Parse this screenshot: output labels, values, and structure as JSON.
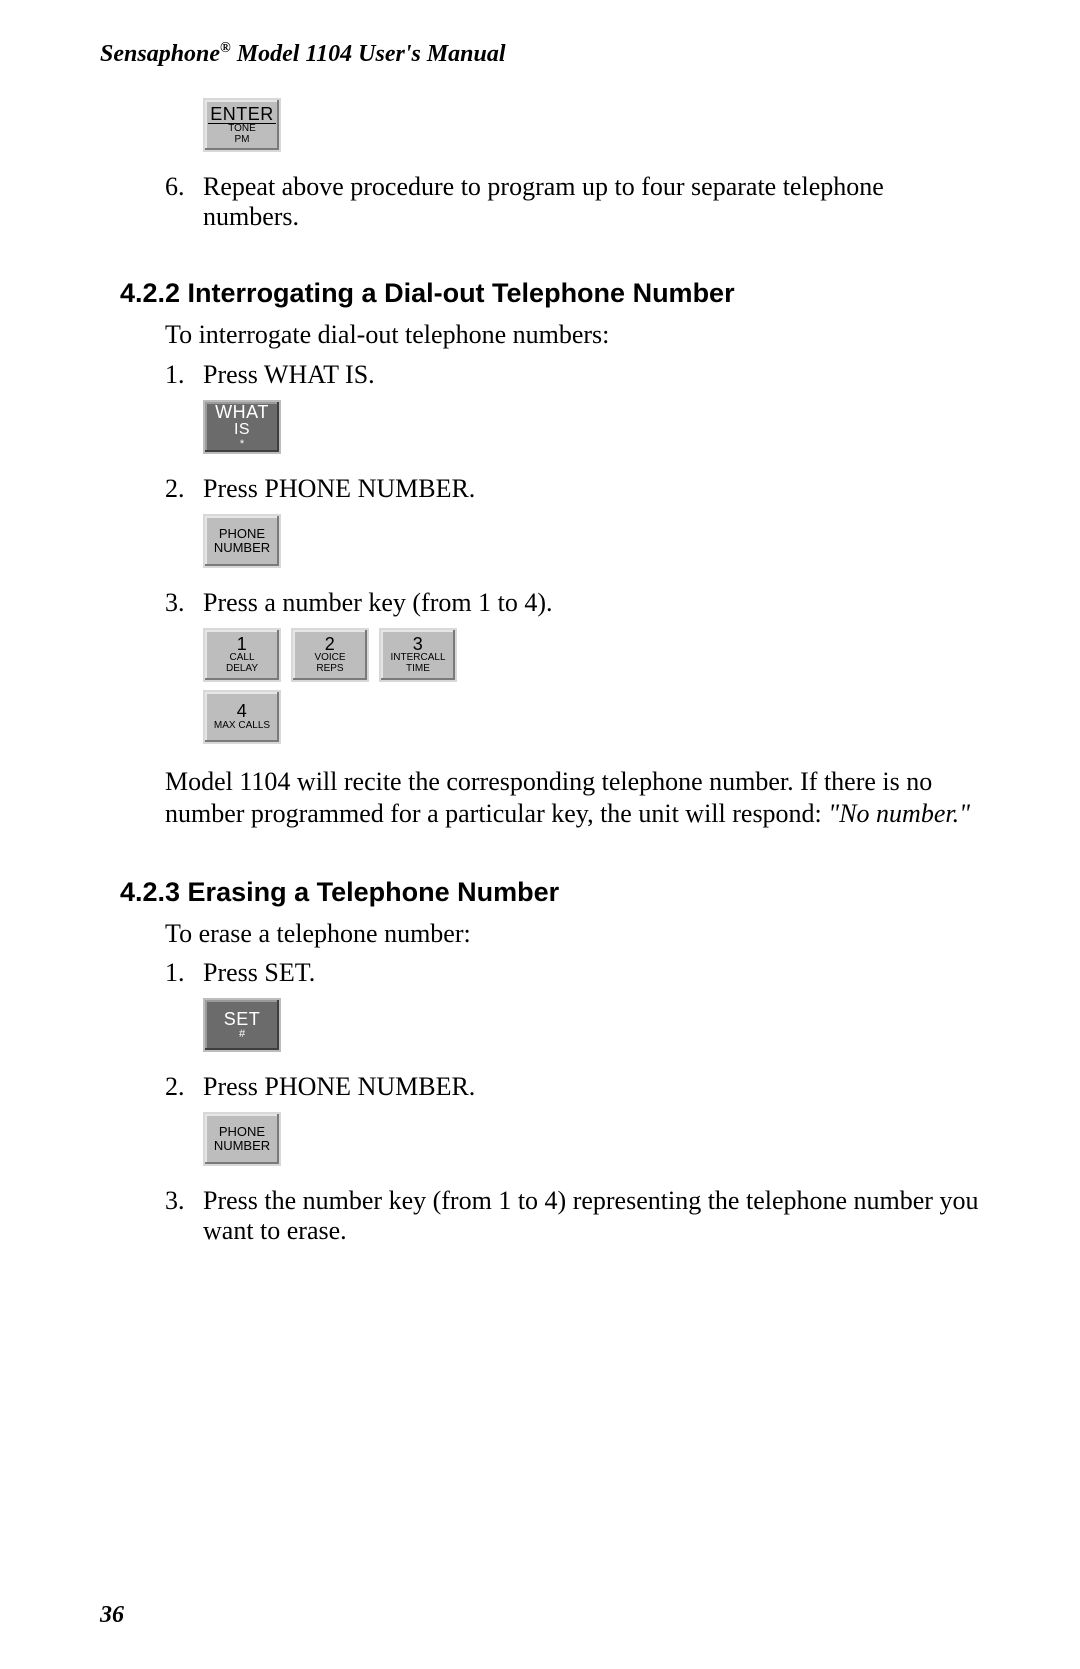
{
  "header": {
    "prefix": "Sensaphone",
    "reg": "®",
    "suffix": " Model 1104 User's Manual"
  },
  "topButton": {
    "line1": "ENTER",
    "line2": "TONE",
    "line3": "PM"
  },
  "item6": {
    "num": "6.",
    "text": "Repeat above procedure to program up to four separate telephone numbers."
  },
  "section422": {
    "heading": "4.2.2  Interrogating a Dial-out Telephone Number",
    "intro": "To interrogate dial-out telephone numbers:",
    "step1": {
      "num": "1.",
      "text": "Press WHAT IS."
    },
    "whatis": {
      "line1": "WHAT",
      "line2": "IS",
      "line3": "*"
    },
    "step2": {
      "num": "2.",
      "text": "Press PHONE NUMBER."
    },
    "phone": {
      "line1": "PHONE",
      "line2": "NUMBER"
    },
    "step3": {
      "num": "3.",
      "text": "Press a number key (from 1 to 4)."
    },
    "keys": {
      "k1": {
        "num": "1",
        "l1": "CALL",
        "l2": "DELAY"
      },
      "k2": {
        "num": "2",
        "l1": "VOICE",
        "l2": "REPS"
      },
      "k3": {
        "num": "3",
        "l1": "INTERCALL",
        "l2": "TIME"
      },
      "k4": {
        "num": "4",
        "l1": "MAX CALLS"
      }
    },
    "outro_a": "Model 1104 will recite the corresponding telephone number. If there is no number programmed for a particular key, the unit will respond: ",
    "outro_em": "\"No number.\""
  },
  "section423": {
    "heading": "4.2.3  Erasing a Telephone Number",
    "intro": "To erase a telephone number:",
    "step1": {
      "num": "1.",
      "text": "Press SET."
    },
    "set": {
      "line1": "SET",
      "line2": "#"
    },
    "step2": {
      "num": "2.",
      "text": "Press PHONE NUMBER."
    },
    "phone": {
      "line1": "PHONE",
      "line2": "NUMBER"
    },
    "step3": {
      "num": "3.",
      "text": "Press the number key (from 1 to 4) representing the telephone number you want to erase."
    }
  },
  "pageNumber": "36"
}
